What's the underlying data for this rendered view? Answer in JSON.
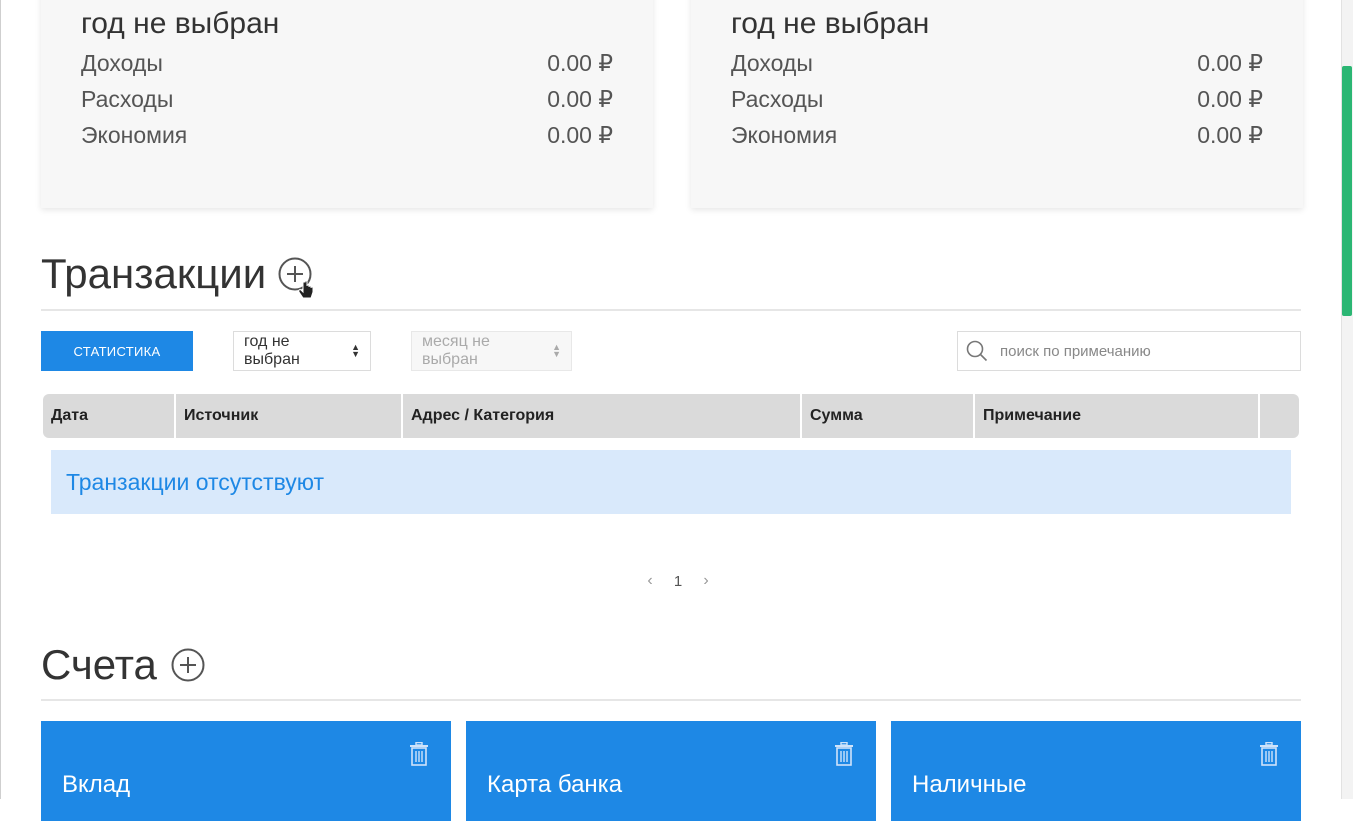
{
  "summary_cards": [
    {
      "year": "год не выбран",
      "rows": [
        {
          "label": "Доходы",
          "value": "0.00 ₽"
        },
        {
          "label": "Расходы",
          "value": "0.00 ₽"
        },
        {
          "label": "Экономия",
          "value": "0.00 ₽"
        }
      ]
    },
    {
      "year": "год не выбран",
      "rows": [
        {
          "label": "Доходы",
          "value": "0.00 ₽"
        },
        {
          "label": "Расходы",
          "value": "0.00 ₽"
        },
        {
          "label": "Экономия",
          "value": "0.00 ₽"
        }
      ]
    }
  ],
  "transactions": {
    "title": "Транзакции",
    "stats_button": "СТАТИСТИКА",
    "year_select": "год не выбран",
    "month_select": "месяц не выбран",
    "search_placeholder": "поиск по примечанию",
    "columns": [
      "Дата",
      "Источник",
      "Адрес / Категория",
      "Сумма",
      "Примечание",
      ""
    ],
    "empty_message": "Транзакции отсутствуют",
    "pagination": {
      "prev": "‹",
      "page": "1",
      "next": "›"
    }
  },
  "accounts": {
    "title": "Счета",
    "items": [
      {
        "name": "Вклад"
      },
      {
        "name": "Карта банка"
      },
      {
        "name": "Наличные"
      }
    ]
  },
  "colors": {
    "primary": "#1e88e5",
    "empty_bg": "#d9e9fb",
    "header_bg": "#dadada",
    "scroll_thumb": "#2bb673"
  },
  "icons": {
    "add_transaction": "plus-circle-icon",
    "add_account": "plus-circle-icon",
    "search": "search-icon",
    "delete": "trash-icon"
  }
}
